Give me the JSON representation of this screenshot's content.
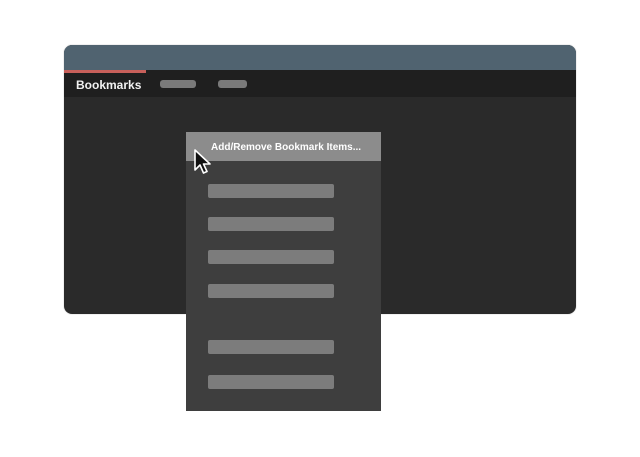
{
  "window": {
    "colors": {
      "titlebar": "#506370",
      "tabbar": "#1f1f1f",
      "content": "#2a2a2a",
      "active_tab_indicator": "#c8605b"
    }
  },
  "tabs": {
    "active_label": "Bookmarks",
    "others": [
      {
        "name": "tab-placeholder-1"
      },
      {
        "name": "tab-placeholder-2"
      }
    ]
  },
  "context_menu": {
    "highlighted_item_label": "Add/Remove Bookmark Items...",
    "items": [
      {
        "name": "menu-item-1"
      },
      {
        "name": "menu-item-2"
      },
      {
        "name": "menu-item-3"
      },
      {
        "name": "menu-item-4"
      },
      {
        "name": "menu-item-5"
      },
      {
        "name": "menu-item-6"
      }
    ],
    "colors": {
      "background": "#3e3e3e",
      "highlight": "#8c8c8c",
      "placeholder": "#7c7c7c"
    }
  },
  "cursor": {
    "icon": "mouse-pointer-icon"
  }
}
